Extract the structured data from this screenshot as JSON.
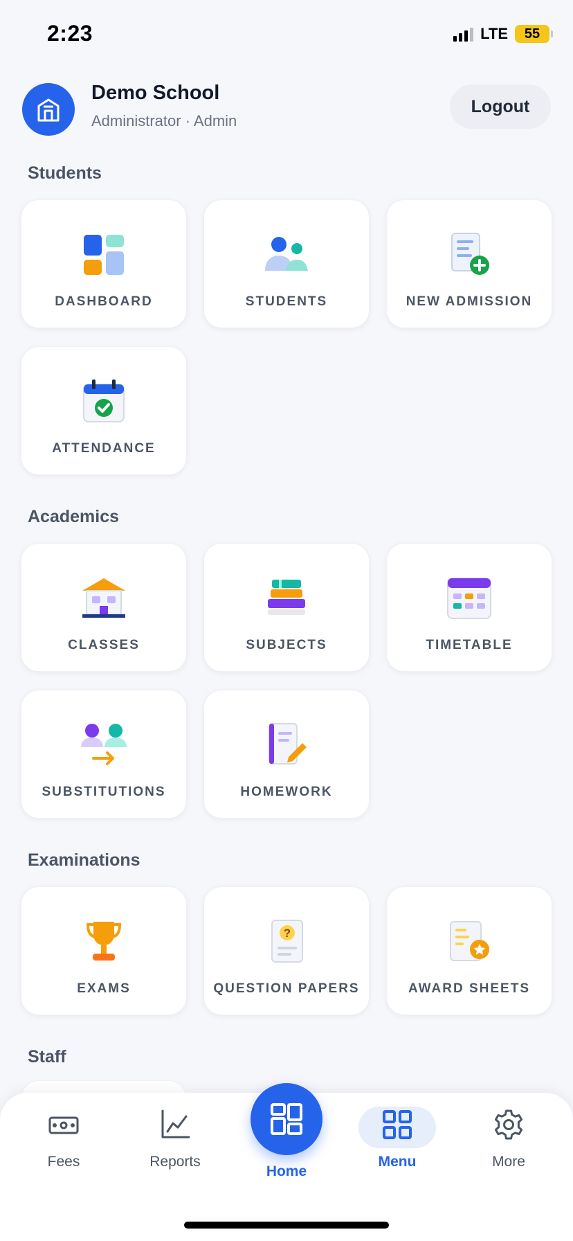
{
  "status_bar": {
    "time": "2:23",
    "network": "LTE",
    "battery": "55"
  },
  "header": {
    "school_name": "Demo School",
    "role": "Administrator · Admin",
    "logout_label": "Logout"
  },
  "sections": [
    {
      "title": "Students",
      "tiles": [
        {
          "label": "DASHBOARD",
          "icon": "dashboard-icon"
        },
        {
          "label": "STUDENTS",
          "icon": "students-icon"
        },
        {
          "label": "NEW ADMISSION",
          "icon": "new-admission-icon"
        },
        {
          "label": "ATTENDANCE",
          "icon": "attendance-icon"
        }
      ]
    },
    {
      "title": "Academics",
      "tiles": [
        {
          "label": "CLASSES",
          "icon": "classes-icon"
        },
        {
          "label": "SUBJECTS",
          "icon": "subjects-icon"
        },
        {
          "label": "TIMETABLE",
          "icon": "timetable-icon"
        },
        {
          "label": "SUBSTITUTIONS",
          "icon": "substitutions-icon"
        },
        {
          "label": "HOMEWORK",
          "icon": "homework-icon"
        }
      ]
    },
    {
      "title": "Examinations",
      "tiles": [
        {
          "label": "EXAMS",
          "icon": "trophy-icon"
        },
        {
          "label": "QUESTION PAPERS",
          "icon": "question-paper-icon"
        },
        {
          "label": "AWARD SHEETS",
          "icon": "award-sheet-icon"
        }
      ]
    },
    {
      "title": "Staff",
      "tiles": []
    }
  ],
  "bottom_nav": {
    "items": [
      {
        "label": "Fees",
        "icon": "cash-icon"
      },
      {
        "label": "Reports",
        "icon": "chart-icon"
      },
      {
        "label": "Home",
        "icon": "home-grid-icon",
        "active": true
      },
      {
        "label": "Menu",
        "icon": "grid-icon",
        "selected": true
      },
      {
        "label": "More",
        "icon": "gear-icon"
      }
    ]
  },
  "colors": {
    "accent": "#2563eb",
    "background": "#f6f7fb",
    "tile": "#ffffff",
    "success": "#16a34a"
  }
}
